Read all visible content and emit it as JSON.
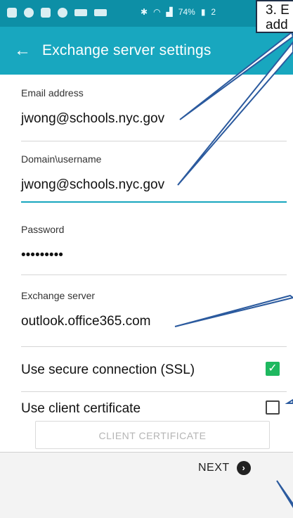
{
  "status_bar": {
    "battery": "74%",
    "time_fragment": "2"
  },
  "app_bar": {
    "title": "Exchange server settings"
  },
  "form": {
    "email": {
      "label": "Email address",
      "value": "jwong@schools.nyc.gov"
    },
    "domain_username": {
      "label": "Domain\\username",
      "value": "jwong@schools.nyc.gov"
    },
    "password": {
      "label": "Password",
      "value": "•••••••••"
    },
    "exchange_server": {
      "label": "Exchange server",
      "value": "outlook.office365.com"
    },
    "ssl": {
      "label": "Use secure connection (SSL)",
      "checked": true
    },
    "client_cert": {
      "label": "Use client certificate",
      "checked": false
    },
    "client_cert_button": "CLIENT CERTIFICATE"
  },
  "bottom": {
    "next_label": "NEXT"
  },
  "annotation": {
    "line1": "3. E",
    "line2": "add"
  },
  "colors": {
    "status_bar": "#0d8fa6",
    "app_bar": "#18a7bf",
    "checkbox_on": "#1eb85f",
    "callout_stroke": "#2b5a9e"
  }
}
